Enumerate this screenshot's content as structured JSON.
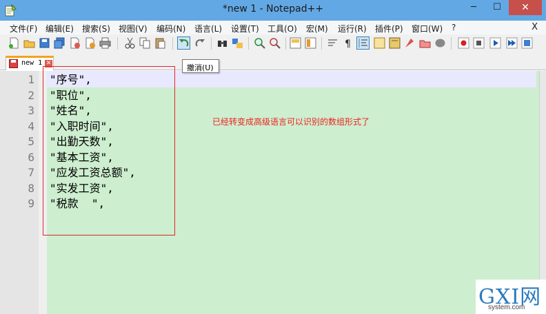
{
  "window": {
    "title": "*new 1 - Notepad++",
    "minimize_glyph": "─",
    "maximize_glyph": "☐",
    "close_glyph": "✕"
  },
  "menubar": {
    "items": [
      "文件(F)",
      "编辑(E)",
      "搜索(S)",
      "视图(V)",
      "编码(N)",
      "语言(L)",
      "设置(T)",
      "工具(O)",
      "宏(M)",
      "运行(R)",
      "插件(P)",
      "窗口(W)",
      "?"
    ],
    "close_glyph": "X"
  },
  "tabs": [
    {
      "label": "new 1",
      "close_glyph": "✕"
    }
  ],
  "tooltip": {
    "text": "撤消(U)"
  },
  "editor": {
    "line_numbers": [
      "1",
      "2",
      "3",
      "4",
      "5",
      "6",
      "7",
      "8",
      "9"
    ],
    "lines": [
      "\"序号\",",
      "\"职位\",",
      "\"姓名\",",
      "\"入职时间\",",
      "\"出勤天数\",",
      "\"基本工资\",",
      "\"应发工资总额\",",
      "\"实发工资\",",
      "\"税款  \","
    ]
  },
  "annotation": {
    "text": "已经转变成高级语言可以识别的数组形式了"
  },
  "watermark": {
    "main": "GXI网",
    "sub": "system.com"
  },
  "colors": {
    "titlebar": "#62a8e5",
    "editor_background": "#cdeecf",
    "annotation": "#ee2222",
    "highlight_box": "#e0262b"
  }
}
